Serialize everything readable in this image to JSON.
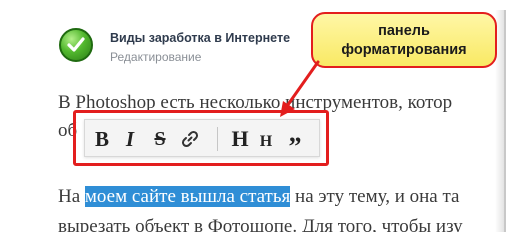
{
  "header": {
    "site_title": "Виды заработка в Интернете",
    "status": "Редактирование"
  },
  "content": {
    "line1": "В Photoshop есть несколько инструментов, котор",
    "line2": "об",
    "line3_before": "На ",
    "line3_highlight": "моем сайте вышла статья",
    "line3_after": " на эту тему, и она та",
    "line4": "вырезать объект в Фотошопе. Для того, чтобы изу"
  },
  "toolbar": {
    "bold": "B",
    "italic": "I",
    "strike": "S",
    "heading1": "H",
    "heading2": "H",
    "quote": "”"
  },
  "callout": {
    "line1": "панель",
    "line2": "форматирования"
  },
  "colors": {
    "highlight": "#2f8ed6",
    "annotation": "#e31e1e",
    "callout_fill": "#f9e964"
  },
  "icons": {
    "logo": "checkmark-icon",
    "link": "link-icon"
  }
}
